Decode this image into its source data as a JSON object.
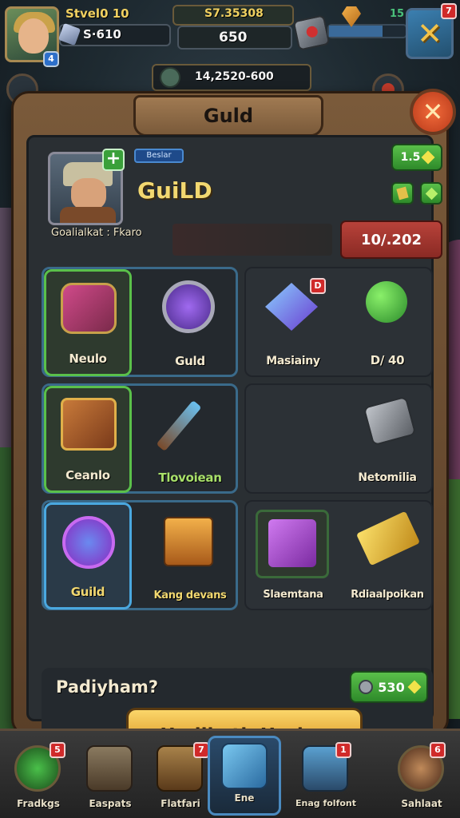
{
  "hud": {
    "player_name": "Stvel0 10",
    "level": "4",
    "gems": "S·610",
    "top_center": "S7.35308",
    "gold": "650",
    "small_value": "15",
    "notif_count": "7",
    "sub_bar_text": "14,2520-600"
  },
  "panel": {
    "title": "Guld",
    "guild": {
      "tag": "Beslar",
      "name": "GuiLD",
      "rank": "1.5",
      "info_label": "Goalialkat",
      "info_value": "Fkaro",
      "members": "10/.202"
    },
    "items": [
      {
        "label": "Neulo",
        "name": "item-neulo"
      },
      {
        "label": "Guld",
        "name": "item-guld"
      },
      {
        "label": "Masiainy",
        "name": "item-masiainy",
        "badge": "D"
      },
      {
        "label": "D/ 40",
        "name": "item-d40"
      },
      {
        "label": "Ceanlo",
        "name": "item-ceanlo"
      },
      {
        "label": "Tlovoiean",
        "name": "item-tlovoiean"
      },
      {
        "label": "Netomilia",
        "name": "item-netomilia"
      },
      {
        "label": "Guild",
        "name": "item-guild"
      },
      {
        "label": "Kang devans",
        "name": "item-kang-devans"
      },
      {
        "label": "Slaemtana",
        "name": "item-slaemtana"
      },
      {
        "label": "Rdiaalpoikan",
        "name": "item-rdiaalpoikan"
      }
    ],
    "bottom": {
      "title": "Padiyham?",
      "cost": "530",
      "action_label": "Hadikath Harjan"
    }
  },
  "nav": [
    {
      "label": "Fradkgs",
      "badge": "5",
      "icon": "compass-icon"
    },
    {
      "label": "Easpats",
      "badge": "",
      "icon": "castle-icon"
    },
    {
      "label": "Flatfari",
      "badge": "7",
      "icon": "scroll-icon"
    },
    {
      "label": "Ene",
      "badge": "",
      "icon": "crystal-icon"
    },
    {
      "label": "Enag folfont",
      "badge": "1",
      "icon": "chest-icon"
    },
    {
      "label": "Sahlaat",
      "badge": "6",
      "icon": "shield-icon"
    }
  ],
  "colors": {
    "panel_wood": "#7a5a3a",
    "accent_gold": "#f2d870",
    "accent_green": "#5ac04a",
    "accent_red": "#b8423a",
    "selection_blue": "#4aa8e0"
  }
}
